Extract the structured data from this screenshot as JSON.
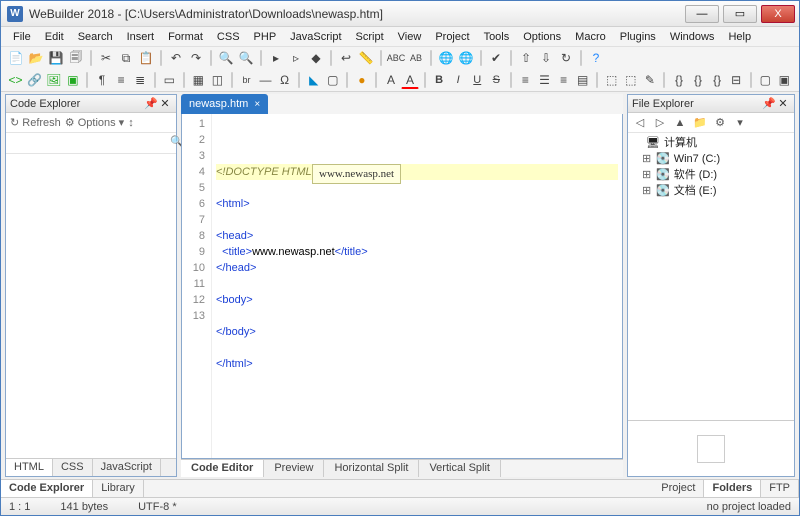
{
  "window": {
    "app_icon_letter": "W",
    "title": "WeBuilder 2018 - [C:\\Users\\Administrator\\Downloads\\newasp.htm]",
    "min": "—",
    "max": "▭",
    "close": "X"
  },
  "menu": [
    "File",
    "Edit",
    "Search",
    "Insert",
    "Format",
    "CSS",
    "PHP",
    "JavaScript",
    "Script",
    "View",
    "Project",
    "Tools",
    "Options",
    "Macro",
    "Plugins",
    "Windows",
    "Help"
  ],
  "left_panel": {
    "title": "Code Explorer",
    "refresh": "↻ Refresh",
    "options": "⚙ Options ▾",
    "sort": "↕",
    "search_placeholder": "",
    "tabs": [
      "HTML",
      "CSS",
      "JavaScript"
    ]
  },
  "bottom_left_tabs": [
    "Code Explorer",
    "Library"
  ],
  "file_tab": {
    "name": "newasp.htm",
    "close": "×"
  },
  "code": {
    "lines": [
      {
        "n": 1,
        "html": "<span class='doct'>&lt;!DOCTYPE HTML&gt;</span>"
      },
      {
        "n": 2,
        "html": ""
      },
      {
        "n": 3,
        "html": "<span class='kw'>&lt;html&gt;</span>"
      },
      {
        "n": 4,
        "html": ""
      },
      {
        "n": 5,
        "html": "<span class='kw'>&lt;head&gt;</span>"
      },
      {
        "n": 6,
        "html": "  <span class='kw'>&lt;title&gt;</span>www.newasp.net<span class='kw'>&lt;/title&gt;</span>"
      },
      {
        "n": 7,
        "html": "<span class='kw'>&lt;/head&gt;</span>"
      },
      {
        "n": 8,
        "html": ""
      },
      {
        "n": 9,
        "html": "<span class='kw'>&lt;body&gt;</span>"
      },
      {
        "n": 10,
        "html": ""
      },
      {
        "n": 11,
        "html": "<span class='kw'>&lt;/body&gt;</span>"
      },
      {
        "n": 12,
        "html": ""
      },
      {
        "n": 13,
        "html": "<span class='kw'>&lt;/html&gt;</span>"
      }
    ],
    "hint": "www.newasp.net"
  },
  "center_tabs": [
    "Code Editor",
    "Preview",
    "Horizontal Split",
    "Vertical Split"
  ],
  "right_panel": {
    "title": "File Explorer",
    "root": "计算机",
    "drives": [
      {
        "exp": "⊞",
        "label": "Win7 (C:)"
      },
      {
        "exp": "⊞",
        "label": "软件 (D:)"
      },
      {
        "exp": "⊞",
        "label": "文档 (E:)"
      }
    ]
  },
  "bottom_right_tabs": [
    "Project",
    "Folders",
    "FTP"
  ],
  "status": {
    "pos": "1 : 1",
    "size": "141 bytes",
    "enc": "UTF-8 *",
    "project": "no project loaded"
  }
}
